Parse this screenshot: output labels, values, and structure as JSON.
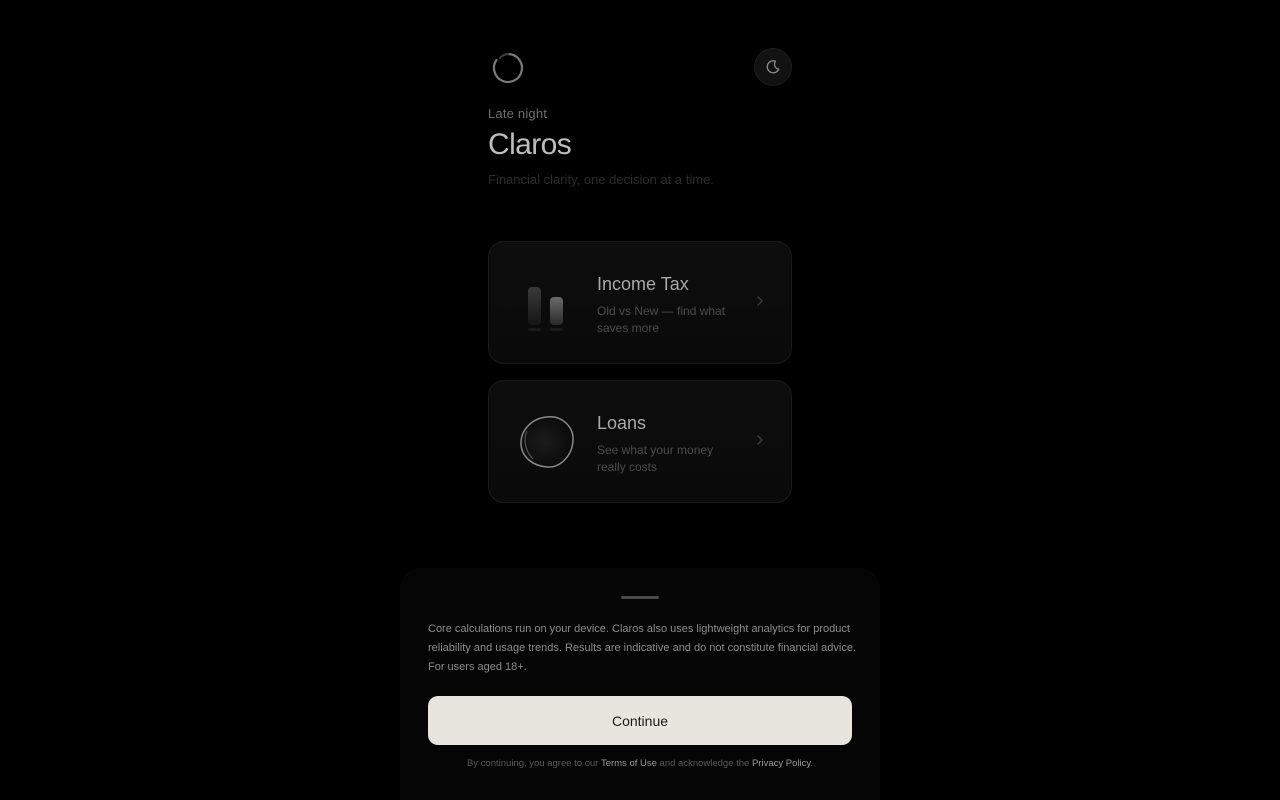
{
  "header": {
    "logo_icon": "ring-logo-icon",
    "theme_toggle_icon": "moon-icon",
    "greeting": "Late night",
    "title": "Claros",
    "tagline": "Financial clarity, one decision at a time."
  },
  "cards": [
    {
      "title": "Income Tax",
      "description": "Old vs New — find what saves more",
      "icon": "bar-pair-icon"
    },
    {
      "title": "Loans",
      "description": "See what your money really costs",
      "icon": "loop-icon"
    }
  ],
  "consent_sheet": {
    "disclaimer": "Core calculations run on your device. Claros also uses lightweight analytics for product reliability and usage trends. Results are indicative and do not constitute financial advice. For users aged 18+.",
    "continue_label": "Continue",
    "legal_prefix": "By continuing, you agree to our",
    "terms_link": "Terms of Use",
    "legal_middle": "and acknowledge the",
    "privacy_link": "Privacy Policy",
    "legal_suffix": "."
  },
  "colors": {
    "background": "#000000",
    "button": "#e8e5de",
    "card_border": "#1a1a1a"
  }
}
